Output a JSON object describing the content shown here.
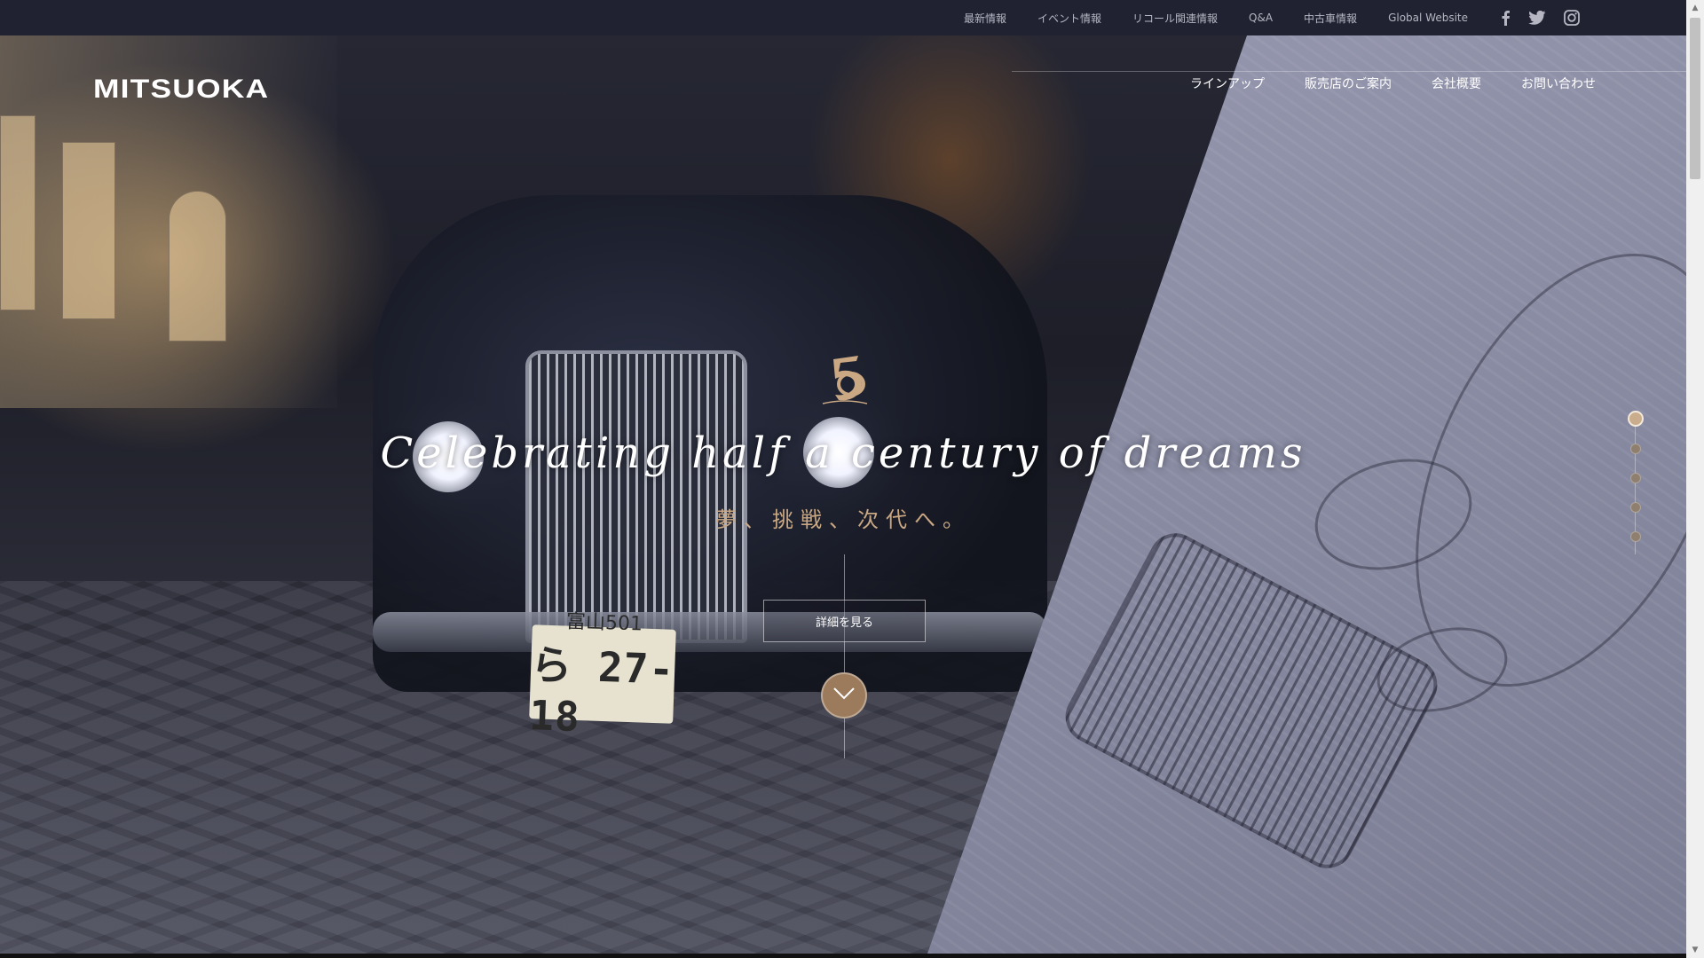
{
  "topbar": {
    "links": [
      "最新情報",
      "イベント情報",
      "リコール関連情報",
      "Q&A",
      "中古車情報",
      "Global Website"
    ],
    "social_icons": [
      "facebook-icon",
      "twitter-icon",
      "instagram-icon"
    ]
  },
  "header": {
    "logo": "MITSUOKA",
    "nav": [
      "ラインアップ",
      "販売店のご案内",
      "会社概要",
      "お問い合わせ"
    ]
  },
  "hero": {
    "emblem_icon": "50th-anniversary-emblem-icon",
    "headline": "Celebrating half a century of dreams",
    "subline": "夢、挑戦、次代へ。",
    "detail_button": "詳細を見る",
    "scroll_icon": "chevron-down-icon",
    "plate_top": "富山501",
    "plate_main": "ら 27-18"
  },
  "slider": {
    "total": 5,
    "active_index": 0
  },
  "colors": {
    "topbar_bg": "#202232",
    "accent_gold": "#c9a883",
    "scroll_button": "#9c7b5c",
    "text_white": "#ffffff"
  }
}
